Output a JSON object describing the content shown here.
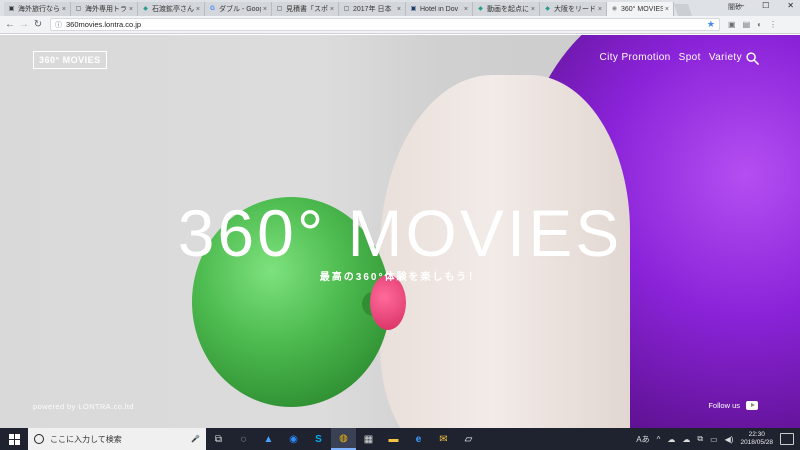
{
  "browser": {
    "tabs": [
      {
        "title": "海外旅行なら",
        "icon": "doc-icon",
        "fav": "▣"
      },
      {
        "title": "海外専用トラ",
        "icon": "doc-icon",
        "fav": "▢"
      },
      {
        "title": "石渡鉱亭さん",
        "icon": "site-icon",
        "fav": "◆"
      },
      {
        "title": "ダブル - Goog",
        "icon": "google-icon",
        "fav": "G"
      },
      {
        "title": "見積書「スポ",
        "icon": "doc-icon",
        "fav": "▢"
      },
      {
        "title": "2017年 日本",
        "icon": "doc-icon",
        "fav": "▢"
      },
      {
        "title": "Hotel in Dov",
        "icon": "site-icon",
        "fav": "▣"
      },
      {
        "title": "動画を起点に",
        "icon": "site-icon",
        "fav": "◆"
      },
      {
        "title": "大阪をリード",
        "icon": "site-icon",
        "fav": "◆"
      },
      {
        "title": "360° MOVIES",
        "icon": "site-icon",
        "fav": "◉"
      }
    ],
    "close_glyph": "×",
    "profile_label": "闇砂",
    "window_controls": [
      "—",
      "☐",
      "✕"
    ],
    "back_glyph": "←",
    "forward_glyph": "→",
    "reload_glyph": "↻",
    "info_glyph": "ⓘ",
    "url": "360movies.lontra.co.jp",
    "star_glyph": "★",
    "extensions": [
      "▣",
      "▤",
      "◐",
      "⋮"
    ]
  },
  "site": {
    "logo": "360° MOVIES",
    "nav": [
      "City Promotion",
      "Spot",
      "Variety"
    ],
    "hero_title": "360° MOVIES",
    "hero_subtitle": "最高の360°体験を楽しもう！",
    "powered_by": "powered by LONTRA.co.ltd",
    "follow_us": "Follow us"
  },
  "taskbar": {
    "search_placeholder": "ここに入力して検索",
    "mic_glyph": "🎤",
    "apps": [
      "task-view-icon",
      "edge-legacy-icon",
      "folder-upload-icon",
      "zoom-icon",
      "skype-icon",
      "chrome-icon",
      "calculator-icon",
      "file-explorer-icon",
      "ie-icon",
      "outlook-icon",
      "sticky-notes-icon"
    ],
    "app_glyphs": [
      "⧉",
      "◌",
      "▲",
      "◉",
      "S",
      "◍",
      "▦",
      "▬",
      "e",
      "✉",
      "▱"
    ],
    "tray_glyphs": [
      "Aあ",
      "^",
      "☁",
      "☁",
      "⧉",
      "▭",
      "◀)"
    ],
    "time": "22:30",
    "date": "2018/05/28"
  },
  "colors": {
    "taskbar_bg": "#1f2330",
    "hair_purple": "#8a23d8",
    "bubble_green": "#4dbb4f",
    "chrome_blue": "#4285f4"
  }
}
